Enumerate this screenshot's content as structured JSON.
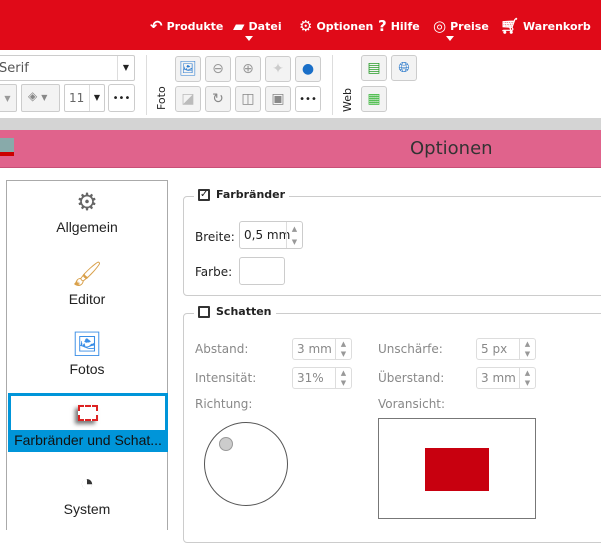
{
  "menu": [
    {
      "label": "Produkte",
      "icon": "undo-arrow-icon"
    },
    {
      "label": "Datei",
      "icon": "folder-icon"
    },
    {
      "label": "Optionen",
      "icon": "gear-icon"
    },
    {
      "label": "Hilfe",
      "icon": "question-icon"
    },
    {
      "label": "Preise",
      "icon": "coins-icon"
    },
    {
      "label": "Warenkorb",
      "icon": "cart-icon"
    }
  ],
  "toolbar": {
    "font": "Serif",
    "font_size": "11",
    "more": "•••",
    "foto_label": "Foto",
    "web_label": "Web"
  },
  "window": {
    "title": "Optionen"
  },
  "sidebar": [
    {
      "label": "Allgemein"
    },
    {
      "label": "Editor"
    },
    {
      "label": "Fotos"
    },
    {
      "label": "Farbränder und Schat..."
    },
    {
      "label": "System"
    }
  ],
  "farbraender": {
    "title": "Farbränder",
    "checked": true,
    "breite_label": "Breite:",
    "breite": "0,5 mm",
    "farbe_label": "Farbe:"
  },
  "schatten": {
    "title": "Schatten",
    "checked": false,
    "abstand_label": "Abstand:",
    "abstand": "3 mm",
    "unschaerfe_label": "Unschärfe:",
    "unschaerfe": "5 px",
    "intensitaet_label": "Intensität:",
    "intensitaet": "31%",
    "ueberstand_label": "Überstand:",
    "ueberstand": "3 mm",
    "richtung_label": "Richtung:",
    "voransicht_label": "Voransicht:"
  },
  "colors": {
    "brand": "#e00a18",
    "title_bar": "#e0638c",
    "selection": "#0095d9",
    "shadow_preview": "#c8000f"
  }
}
